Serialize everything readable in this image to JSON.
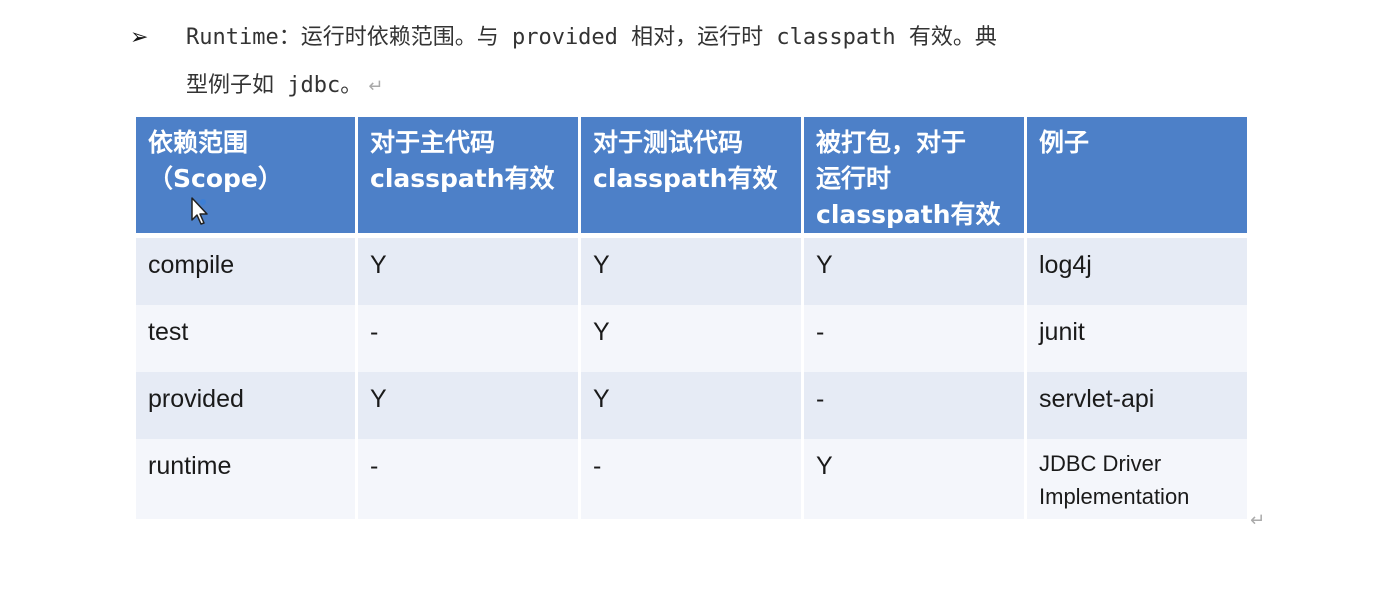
{
  "paragraph": {
    "bullet": "➢",
    "line1": "Runtime：运行时依赖范围。与 provided 相对，运行时 classpath 有效。典",
    "line2": "型例子如 jdbc。",
    "return_mark": "↵"
  },
  "table": {
    "headers": [
      [
        "依赖范围",
        "（Scope）"
      ],
      [
        "对于主代码",
        "classpath有效"
      ],
      [
        "对于测试代码",
        "classpath有效"
      ],
      [
        "被打包，对于",
        "运行时",
        "classpath有效"
      ],
      [
        "例子"
      ]
    ],
    "rows": [
      [
        "compile",
        "Y",
        "Y",
        "Y",
        "log4j"
      ],
      [
        "test",
        "-",
        "Y",
        "-",
        "junit"
      ],
      [
        "provided",
        "Y",
        "Y",
        "-",
        "servlet-api"
      ],
      [
        "runtime",
        "-",
        "-",
        "Y",
        "JDBC Driver Implementation"
      ]
    ]
  },
  "end_mark": "↵",
  "icons": {
    "bullet": "arrowhead-bullet-icon",
    "cursor": "mouse-pointer-icon"
  },
  "colors": {
    "header_bg": "#4d80c8",
    "row_odd_bg": "#e6ebf5",
    "row_even_bg": "#f4f6fb"
  }
}
